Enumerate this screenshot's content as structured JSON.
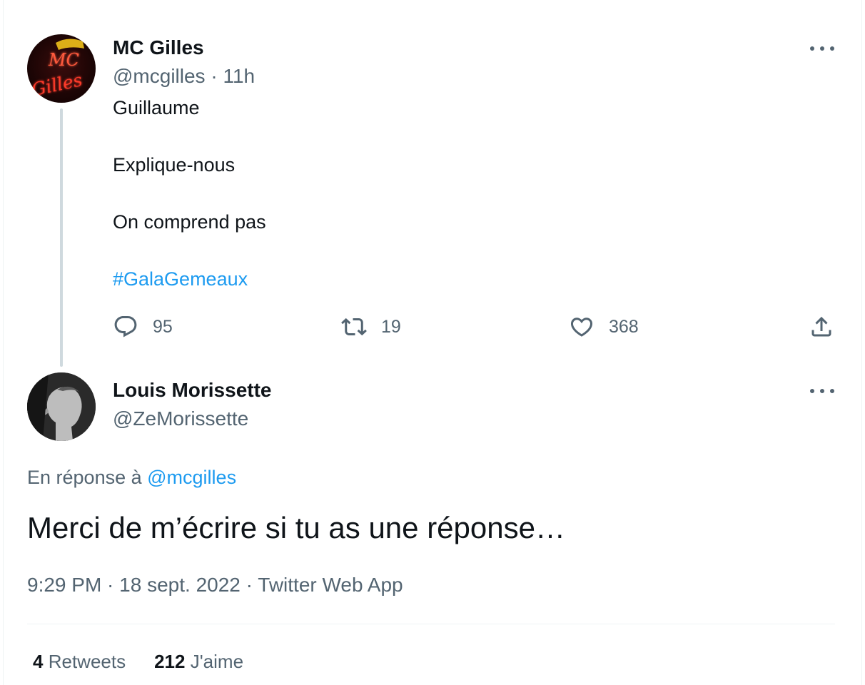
{
  "parent_tweet": {
    "author_name": "MC Gilles",
    "handle": "@mcgilles",
    "separator": "·",
    "time": "11h",
    "avatar_text": [
      "MC",
      "Gilles"
    ],
    "lines": [
      "Guillaume",
      "Explique-nous",
      "On comprend pas"
    ],
    "hashtag": "#GalaGemeaux",
    "actions": {
      "reply_count": "95",
      "retweet_count": "19",
      "like_count": "368"
    }
  },
  "focused_tweet": {
    "author_name": "Louis Morissette",
    "handle": "@ZeMorissette",
    "replying_prefix": "En réponse à",
    "replying_to": "@mcgilles",
    "text": "Merci de m’écrire si tu as une réponse…",
    "time": "9:29 PM",
    "date": "18 sept. 2022",
    "source": "Twitter Web App",
    "meta_separator": " · ",
    "stats": {
      "retweets_count": "4",
      "retweets_label": "Retweets",
      "likes_count": "212",
      "likes_label": "J'aime"
    }
  },
  "icons": {
    "reply": "reply-icon",
    "retweet": "retweet-icon",
    "like": "heart-icon",
    "share": "share-icon",
    "more": "more-icon"
  },
  "colors": {
    "link": "#1d9bf0",
    "secondary_text": "#536471",
    "primary_text": "#0f1419",
    "thread_line": "#cfd9de"
  }
}
